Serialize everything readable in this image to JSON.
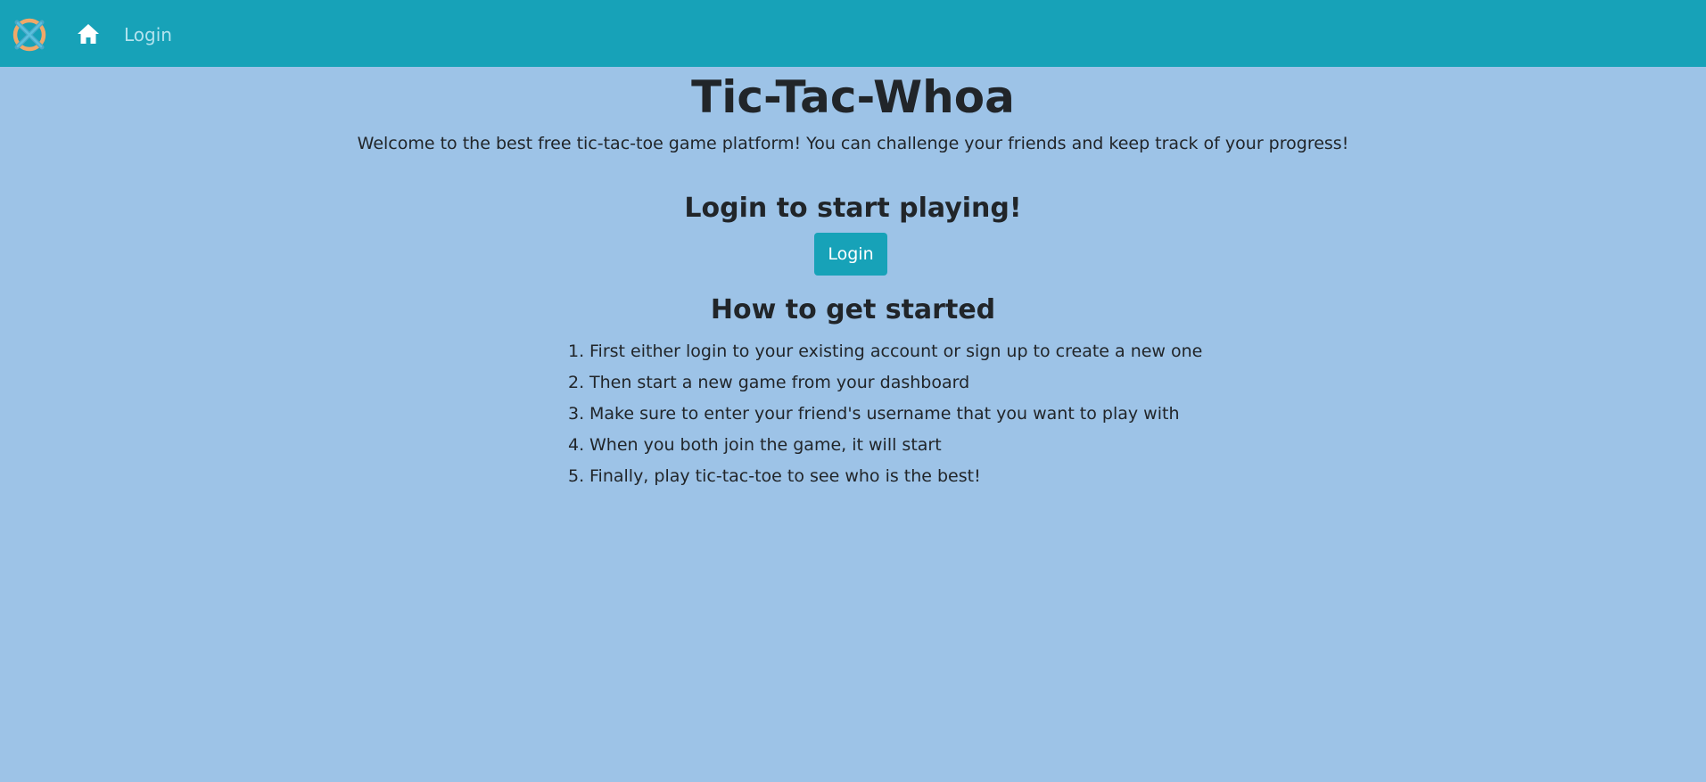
{
  "navbar": {
    "logo_icon": "tic-tac-toe-logo-icon",
    "home_icon": "home-icon",
    "login_link": "Login",
    "colors": {
      "background": "#17a2b8",
      "link": "#b3e3ee"
    }
  },
  "main": {
    "title": "Tic-Tac-Whoa",
    "subtitle": "Welcome to the best free tic-tac-toe game platform! You can challenge your friends and keep track of your progress!",
    "cta_heading": "Login to start playing!",
    "login_button": "Login",
    "howto_heading": "How to get started",
    "steps": [
      {
        "num": "1.",
        "text": "First either login to your existing account or sign up to create a new one"
      },
      {
        "num": "2.",
        "text": "Then start a new game from your dashboard"
      },
      {
        "num": "3.",
        "text": "Make sure to enter your friend's username that you want to play with"
      },
      {
        "num": "4.",
        "text": "When you both join the game, it will start"
      },
      {
        "num": "5.",
        "text": "Finally, play tic-tac-toe to see who is the best!"
      }
    ]
  },
  "colors": {
    "page_background": "#9dc3e7",
    "text": "#212529",
    "button": "#17a2b8"
  }
}
